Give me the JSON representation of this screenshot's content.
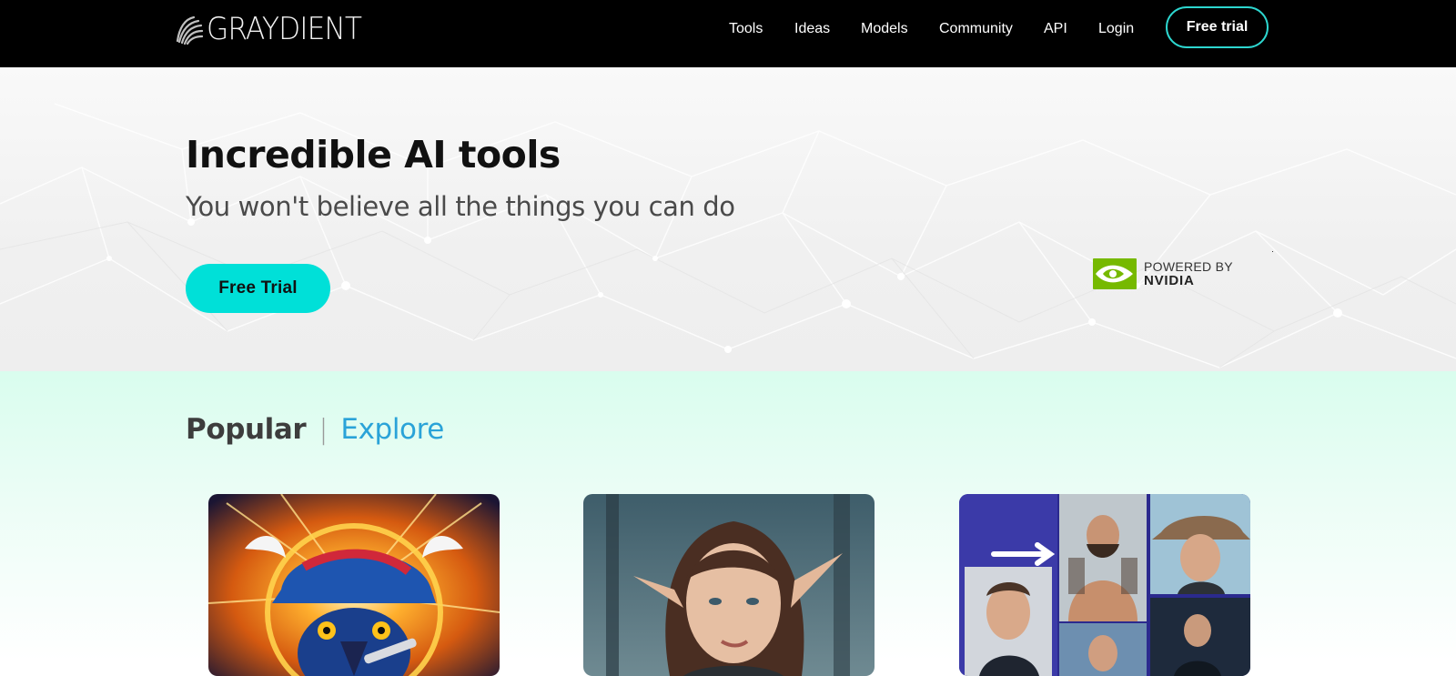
{
  "header": {
    "brand": "GRAYDIENT",
    "nav": [
      "Tools",
      "Ideas",
      "Models",
      "Community",
      "API",
      "Login"
    ],
    "trial_label": "Free trial"
  },
  "hero": {
    "title": "Incredible AI tools",
    "subtitle": "You won't believe all the things you can do",
    "cta_label": "Free Trial",
    "powered_prefix": "POWERED BY",
    "powered_brand": "NVIDIA"
  },
  "gallery": {
    "tab_popular": "Popular",
    "separator": "|",
    "tab_explore": "Explore",
    "cards": [
      "pirate-parrot-artwork",
      "elf-portrait-artwork",
      "photo-transformation-collage"
    ]
  },
  "colors": {
    "nav_bg": "#000000",
    "accent_teal": "#00e0d8",
    "trial_border": "#2dd6cf",
    "explore_link": "#2aa3d8",
    "nvidia_green": "#76b900",
    "section_mint": "#d9fdee"
  },
  "icons": {
    "logo": "shell-fan-logo-icon",
    "nvidia": "nvidia-eye-icon"
  }
}
